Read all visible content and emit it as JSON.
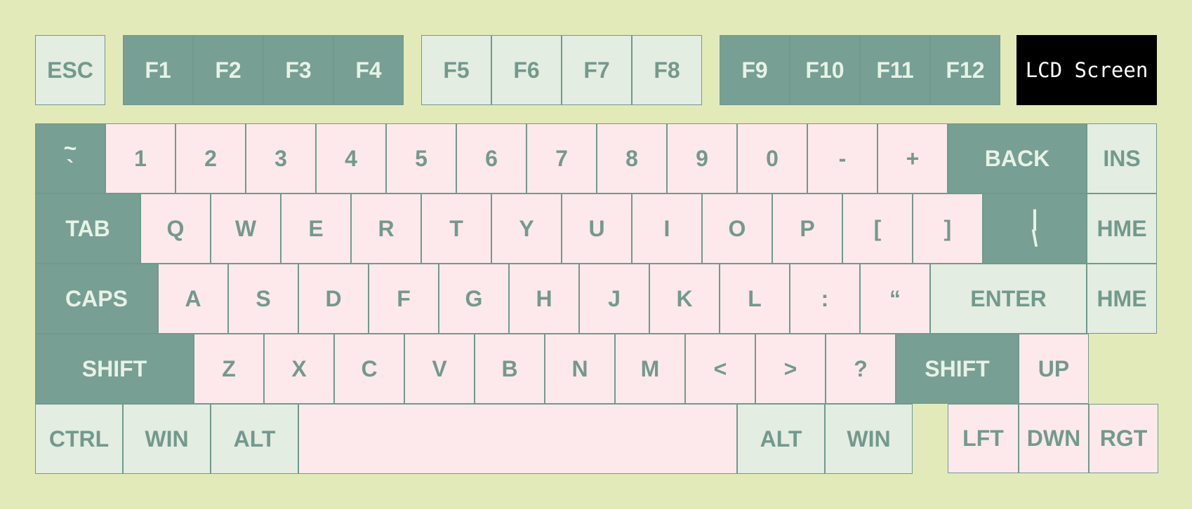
{
  "function_row": {
    "esc": "ESC",
    "f1": "F1",
    "f2": "F2",
    "f3": "F3",
    "f4": "F4",
    "f5": "F5",
    "f6": "F6",
    "f7": "F7",
    "f8": "F8",
    "f9": "F9",
    "f10": "F10",
    "f11": "F11",
    "f12": "F12"
  },
  "lcd": {
    "text": "LCD Screen"
  },
  "number_row": {
    "tilde_top": "~",
    "tilde_bottom": "`",
    "k1": "1",
    "k2": "2",
    "k3": "3",
    "k4": "4",
    "k5": "5",
    "k6": "6",
    "k7": "7",
    "k8": "8",
    "k9": "9",
    "k0": "0",
    "minus": "-",
    "plus": "+",
    "back": "BACK",
    "ins": "INS"
  },
  "top_row": {
    "tab": "TAB",
    "q": "Q",
    "w": "W",
    "e": "E",
    "r": "R",
    "t": "T",
    "y": "Y",
    "u": "U",
    "i": "I",
    "o": "O",
    "p": "P",
    "lbracket": "[",
    "rbracket": "]",
    "pipe_top": "|",
    "pipe_bottom": "\\",
    "hme": "HME"
  },
  "home_row": {
    "caps": "CAPS",
    "a": "A",
    "s": "S",
    "d": "D",
    "f": "F",
    "g": "G",
    "h": "H",
    "j": "J",
    "k": "K",
    "l": "L",
    "colon": ":",
    "quote": "“",
    "enter": "ENTER",
    "hme": "HME"
  },
  "bottom_row": {
    "shift_left": "SHIFT",
    "z": "Z",
    "x": "X",
    "c": "C",
    "v": "V",
    "b": "B",
    "n": "N",
    "m": "M",
    "lt": "<",
    "gt": ">",
    "question": "?",
    "shift_right": "SHIFT",
    "up": "UP"
  },
  "modifier_row": {
    "ctrl": "CTRL",
    "win_left": "WIN",
    "alt_left": "ALT",
    "space": "",
    "alt_right": "ALT",
    "win_right": "WIN",
    "left": "LFT",
    "down": "DWN",
    "right": "RGT"
  }
}
